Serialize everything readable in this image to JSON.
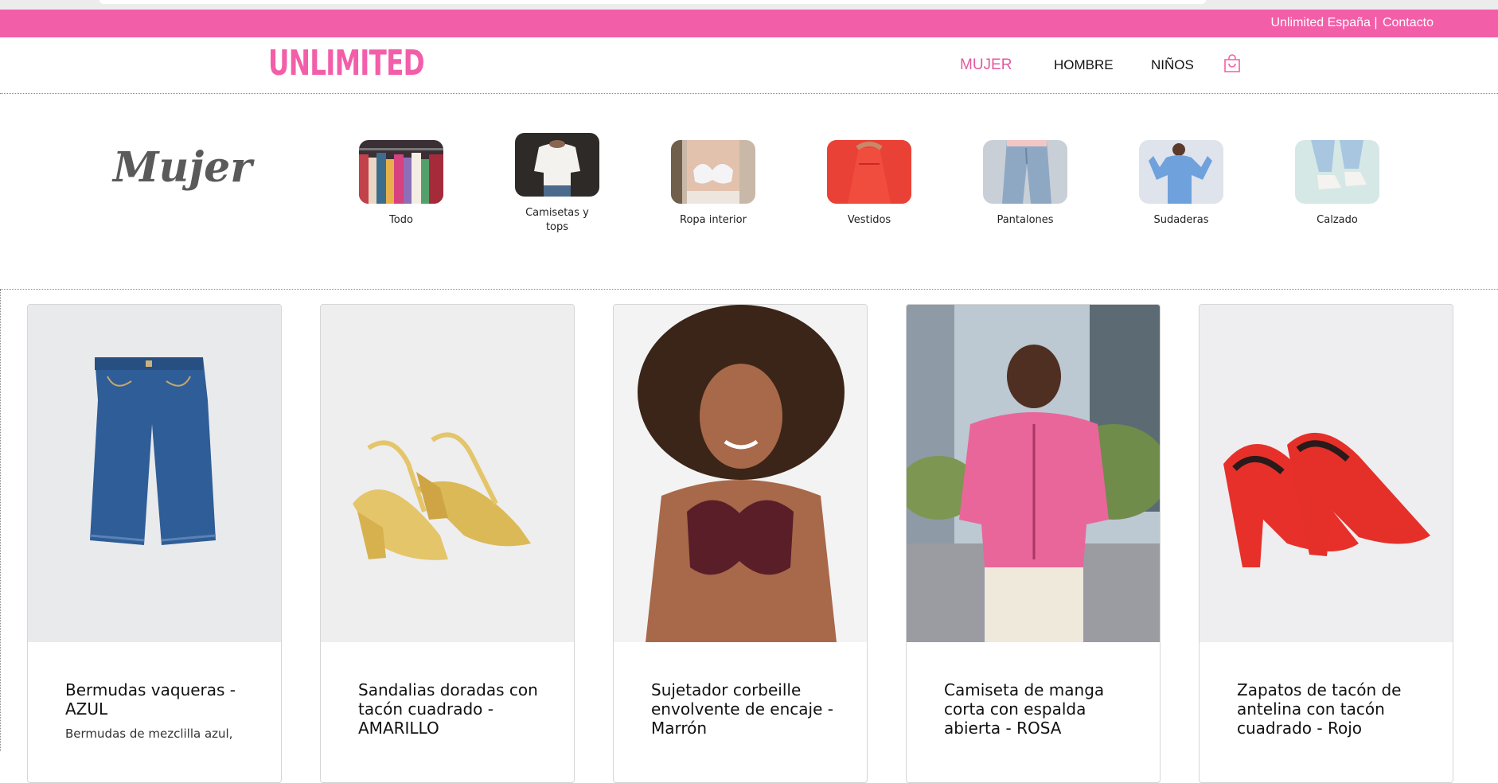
{
  "topbar": {
    "site_link": "Unlimited España |",
    "contact_link": "Contacto",
    "color": "#f35ea9"
  },
  "header": {
    "logo": "UNLIMITED",
    "nav": [
      {
        "label": "MUJER",
        "active": true
      },
      {
        "label": "HOMBRE",
        "active": false
      },
      {
        "label": "NIÑOS",
        "active": false
      }
    ],
    "cart_icon": "shopping-bag-icon"
  },
  "section": {
    "title": "Mujer",
    "categories": [
      {
        "label": "Todo"
      },
      {
        "label": "Camisetas y tops"
      },
      {
        "label": "Ropa interior"
      },
      {
        "label": "Vestidos"
      },
      {
        "label": "Pantalones"
      },
      {
        "label": "Sudaderas"
      },
      {
        "label": "Calzado"
      }
    ]
  },
  "products": [
    {
      "title": "Bermudas vaqueras - AZUL",
      "desc": "Bermudas de mezclilla azul,"
    },
    {
      "title": "Sandalias doradas con tacón cuadrado - AMARILLO",
      "desc": ""
    },
    {
      "title": "Sujetador corbeille envolvente de encaje - Marrón",
      "desc": ""
    },
    {
      "title": "Camiseta de manga corta con espalda abierta - ROSA",
      "desc": ""
    },
    {
      "title": "Zapatos de tacón de antelina con tacón cuadrado - Rojo",
      "desc": ""
    }
  ]
}
